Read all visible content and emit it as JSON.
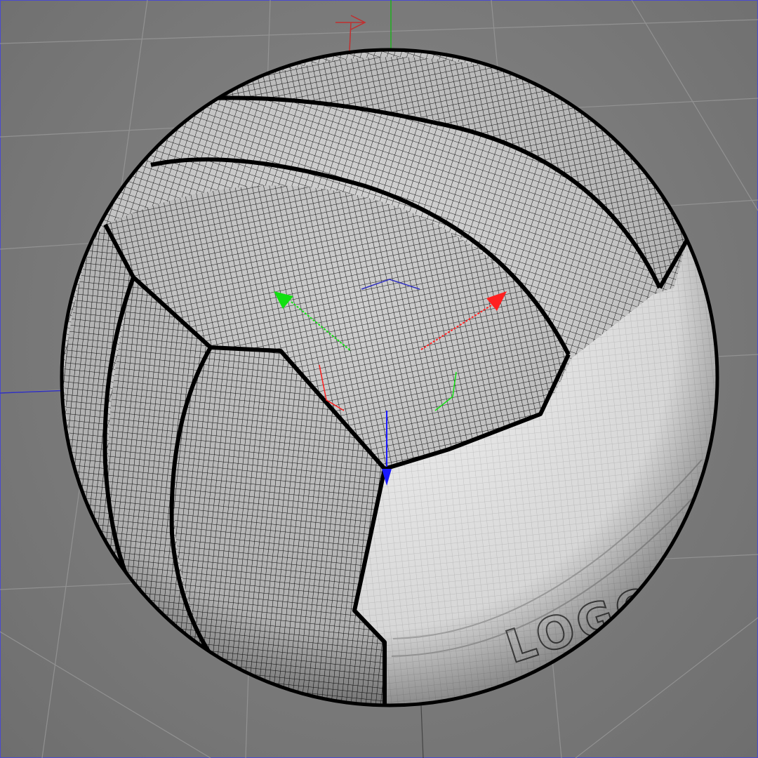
{
  "viewport": {
    "mode": "perspective-wireframe",
    "background": "#7d7d7d",
    "grid_color": "#9a9a9a"
  },
  "model": {
    "type": "volleyball",
    "wire_color": "#000000",
    "white_panel_color": "#f2f2f2",
    "logo_text": "LOGO"
  },
  "gizmo": {
    "x_axis_color": "#ff2020",
    "y_axis_color": "#10e010",
    "z_axis_color": "#1a1aff"
  },
  "world_axes": {
    "x_color": "#c03030",
    "y_color": "#20b020",
    "z_color": "#3030c0"
  }
}
